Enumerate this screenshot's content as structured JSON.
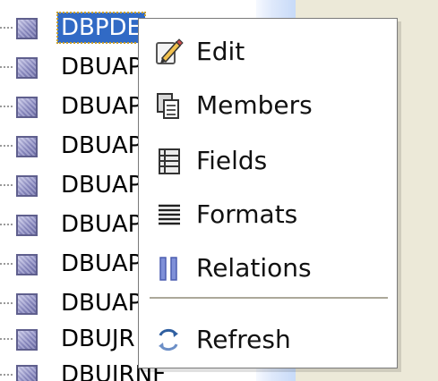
{
  "tree": {
    "items": [
      {
        "label": "DBPDE"
      },
      {
        "label": "DBUAP"
      },
      {
        "label": "DBUAP"
      },
      {
        "label": "DBUAP"
      },
      {
        "label": "DBUAP"
      },
      {
        "label": "DBUAP"
      },
      {
        "label": "DBUAP"
      },
      {
        "label": "DBUAP"
      },
      {
        "label": "DBUJR"
      },
      {
        "label": "DBUJRNF"
      }
    ]
  },
  "context_menu": {
    "items": [
      {
        "label": "Edit",
        "icon": "edit-icon"
      },
      {
        "label": "Members",
        "icon": "members-icon"
      },
      {
        "label": "Fields",
        "icon": "fields-icon"
      },
      {
        "label": "Formats",
        "icon": "formats-icon"
      },
      {
        "label": "Relations",
        "icon": "relations-icon"
      },
      {
        "label": "Refresh",
        "icon": "refresh-icon"
      }
    ]
  }
}
